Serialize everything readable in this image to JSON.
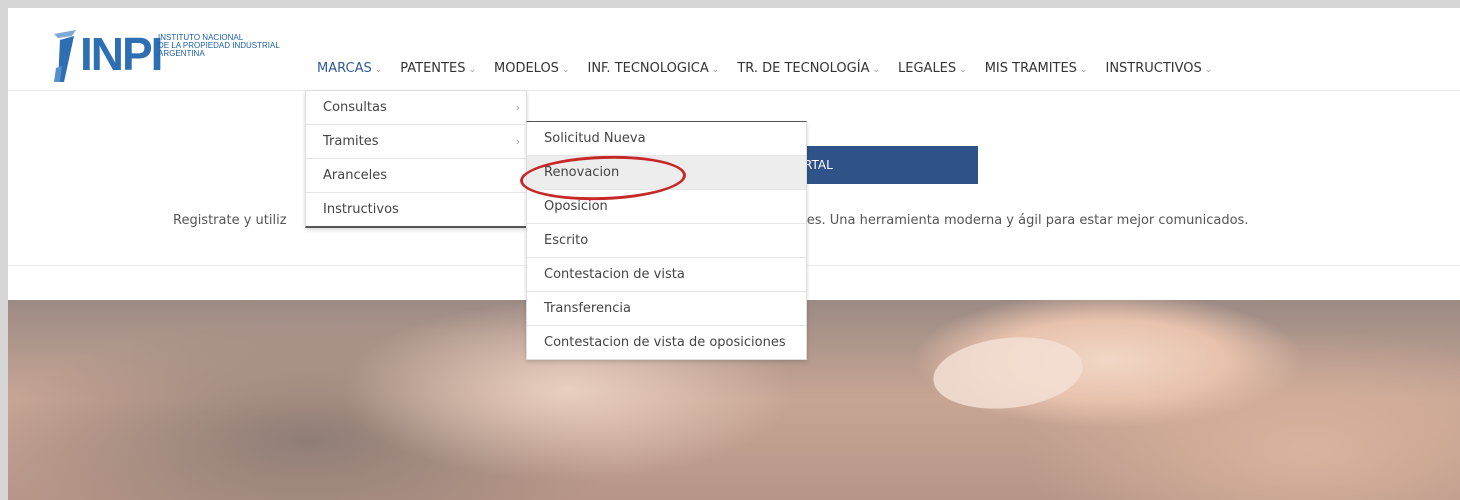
{
  "logo": {
    "wordmark": "INPI",
    "subtitle_lines": [
      "INSTITUTO NACIONAL",
      "DE LA PROPIEDAD INDUSTRIAL",
      "ARGENTINA"
    ],
    "brand_color": "#2e6eb3"
  },
  "nav": {
    "items": [
      {
        "label": "MARCAS"
      },
      {
        "label": "PATENTES"
      },
      {
        "label": "MODELOS"
      },
      {
        "label": "INF. TECNOLOGICA"
      },
      {
        "label": "TR. DE TECNOLOGÍA"
      },
      {
        "label": "LEGALES"
      },
      {
        "label": "MIS TRAMITES"
      },
      {
        "label": "INSTRUCTIVOS"
      }
    ],
    "chevron": "⌄"
  },
  "marcas_menu": {
    "items": [
      {
        "label": "Consultas",
        "arrow": "›"
      },
      {
        "label": "Tramites",
        "arrow": "›"
      },
      {
        "label": "Aranceles"
      },
      {
        "label": "Instructivos"
      }
    ]
  },
  "tramites_menu": {
    "items": [
      {
        "label": "Solicitud Nueva"
      },
      {
        "label": "Renovacion"
      },
      {
        "label": "Oposicion"
      },
      {
        "label": "Escrito"
      },
      {
        "label": "Contestacion de vista"
      },
      {
        "label": "Transferencia"
      },
      {
        "label": "Contestacion de vista de oposiciones"
      }
    ],
    "highlighted": "Renovacion",
    "annotation_color": "#c62828"
  },
  "banner": {
    "button_label_visible": "RTAL",
    "button_color": "#2f5288"
  },
  "promo": {
    "left_text": "Registrate y utiliz",
    "right_text": "ites. Una herramienta moderna y ágil para estar mejor comunicados."
  }
}
